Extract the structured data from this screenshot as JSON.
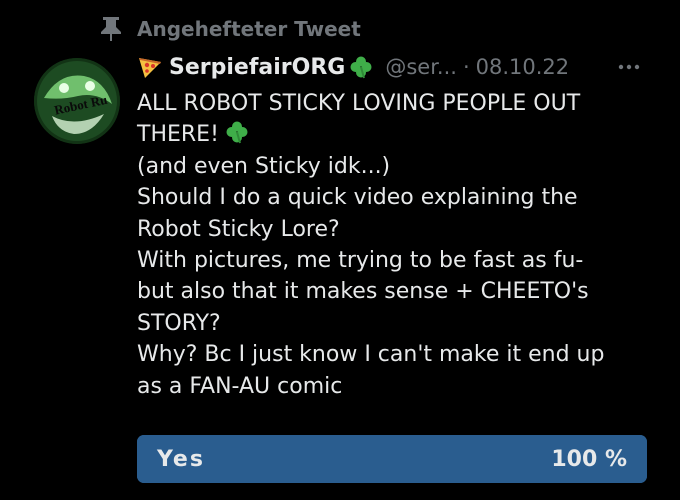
{
  "pinned": {
    "label": "Angehefteter Tweet",
    "icon": "pin-icon"
  },
  "tweet": {
    "display_name": "SerpiefairORG",
    "handle": "@ser...",
    "separator": "·",
    "date": "08.10.22",
    "lines": [
      "ALL ROBOT STICKY LOVING PEOPLE OUT",
      "THERE!",
      "(and even Sticky idk...)",
      "Should I do a quick video explaining the",
      "Robot Sticky Lore?",
      "With pictures, me trying to be fast as fu-",
      "but also that it makes sense + CHEETO's",
      "STORY?",
      "Why? Bc I just know I can't make it end up",
      "as a FAN-AU comic"
    ]
  },
  "avatar": {
    "text": "Robot Ru"
  },
  "poll": {
    "option": "Yes",
    "percent_label": "100 %",
    "percent": 100,
    "bar_color": "#2a5d8f"
  },
  "colors": {
    "background": "#000000",
    "text": "#e7e9ea",
    "muted": "#71767b",
    "clover": "#3fae49"
  }
}
